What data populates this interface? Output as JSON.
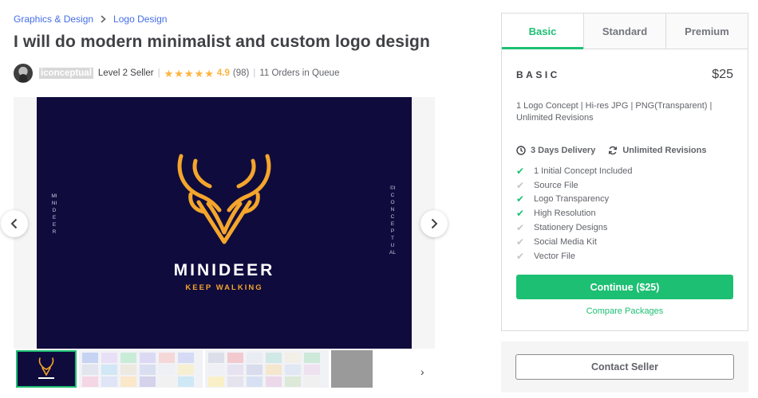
{
  "breadcrumb": {
    "items": [
      "Graphics & Design",
      "Logo Design"
    ]
  },
  "gig": {
    "title": "I will do modern minimalist and custom logo design"
  },
  "seller": {
    "name": "iconceptual",
    "level": "Level 2 Seller",
    "rating": "4.9",
    "star_count": 5,
    "reviews": "(98)",
    "queue": "11 Orders in Queue"
  },
  "gallery": {
    "brand_name": "MINIDEER",
    "tagline": "KEEP WALKING",
    "left_vertical_text": "MINIDEER",
    "right_vertical_text": "©ICONCEPTUAL",
    "background_color": "#0f0b3d",
    "accent_color": "#f4a52b"
  },
  "packages": {
    "tabs": [
      "Basic",
      "Standard",
      "Premium"
    ],
    "active_tab": "Basic",
    "name": "BASIC",
    "price": "$25",
    "description": "1 Logo Concept | Hi-res JPG | PNG(Transparent) | Unlimited Revisions",
    "delivery": "3 Days Delivery",
    "revisions": "Unlimited Revisions",
    "features": [
      {
        "label": "1 Initial Concept Included",
        "included": true
      },
      {
        "label": "Source File",
        "included": false
      },
      {
        "label": "Logo Transparency",
        "included": true
      },
      {
        "label": "High Resolution",
        "included": true
      },
      {
        "label": "Stationery Designs",
        "included": false
      },
      {
        "label": "Social Media Kit",
        "included": false
      },
      {
        "label": "Vector File",
        "included": false
      }
    ],
    "continue_label": "Continue ($25)",
    "compare_label": "Compare Packages",
    "accent_color": "#1dbf73"
  },
  "contact": {
    "label": "Contact Seller"
  }
}
